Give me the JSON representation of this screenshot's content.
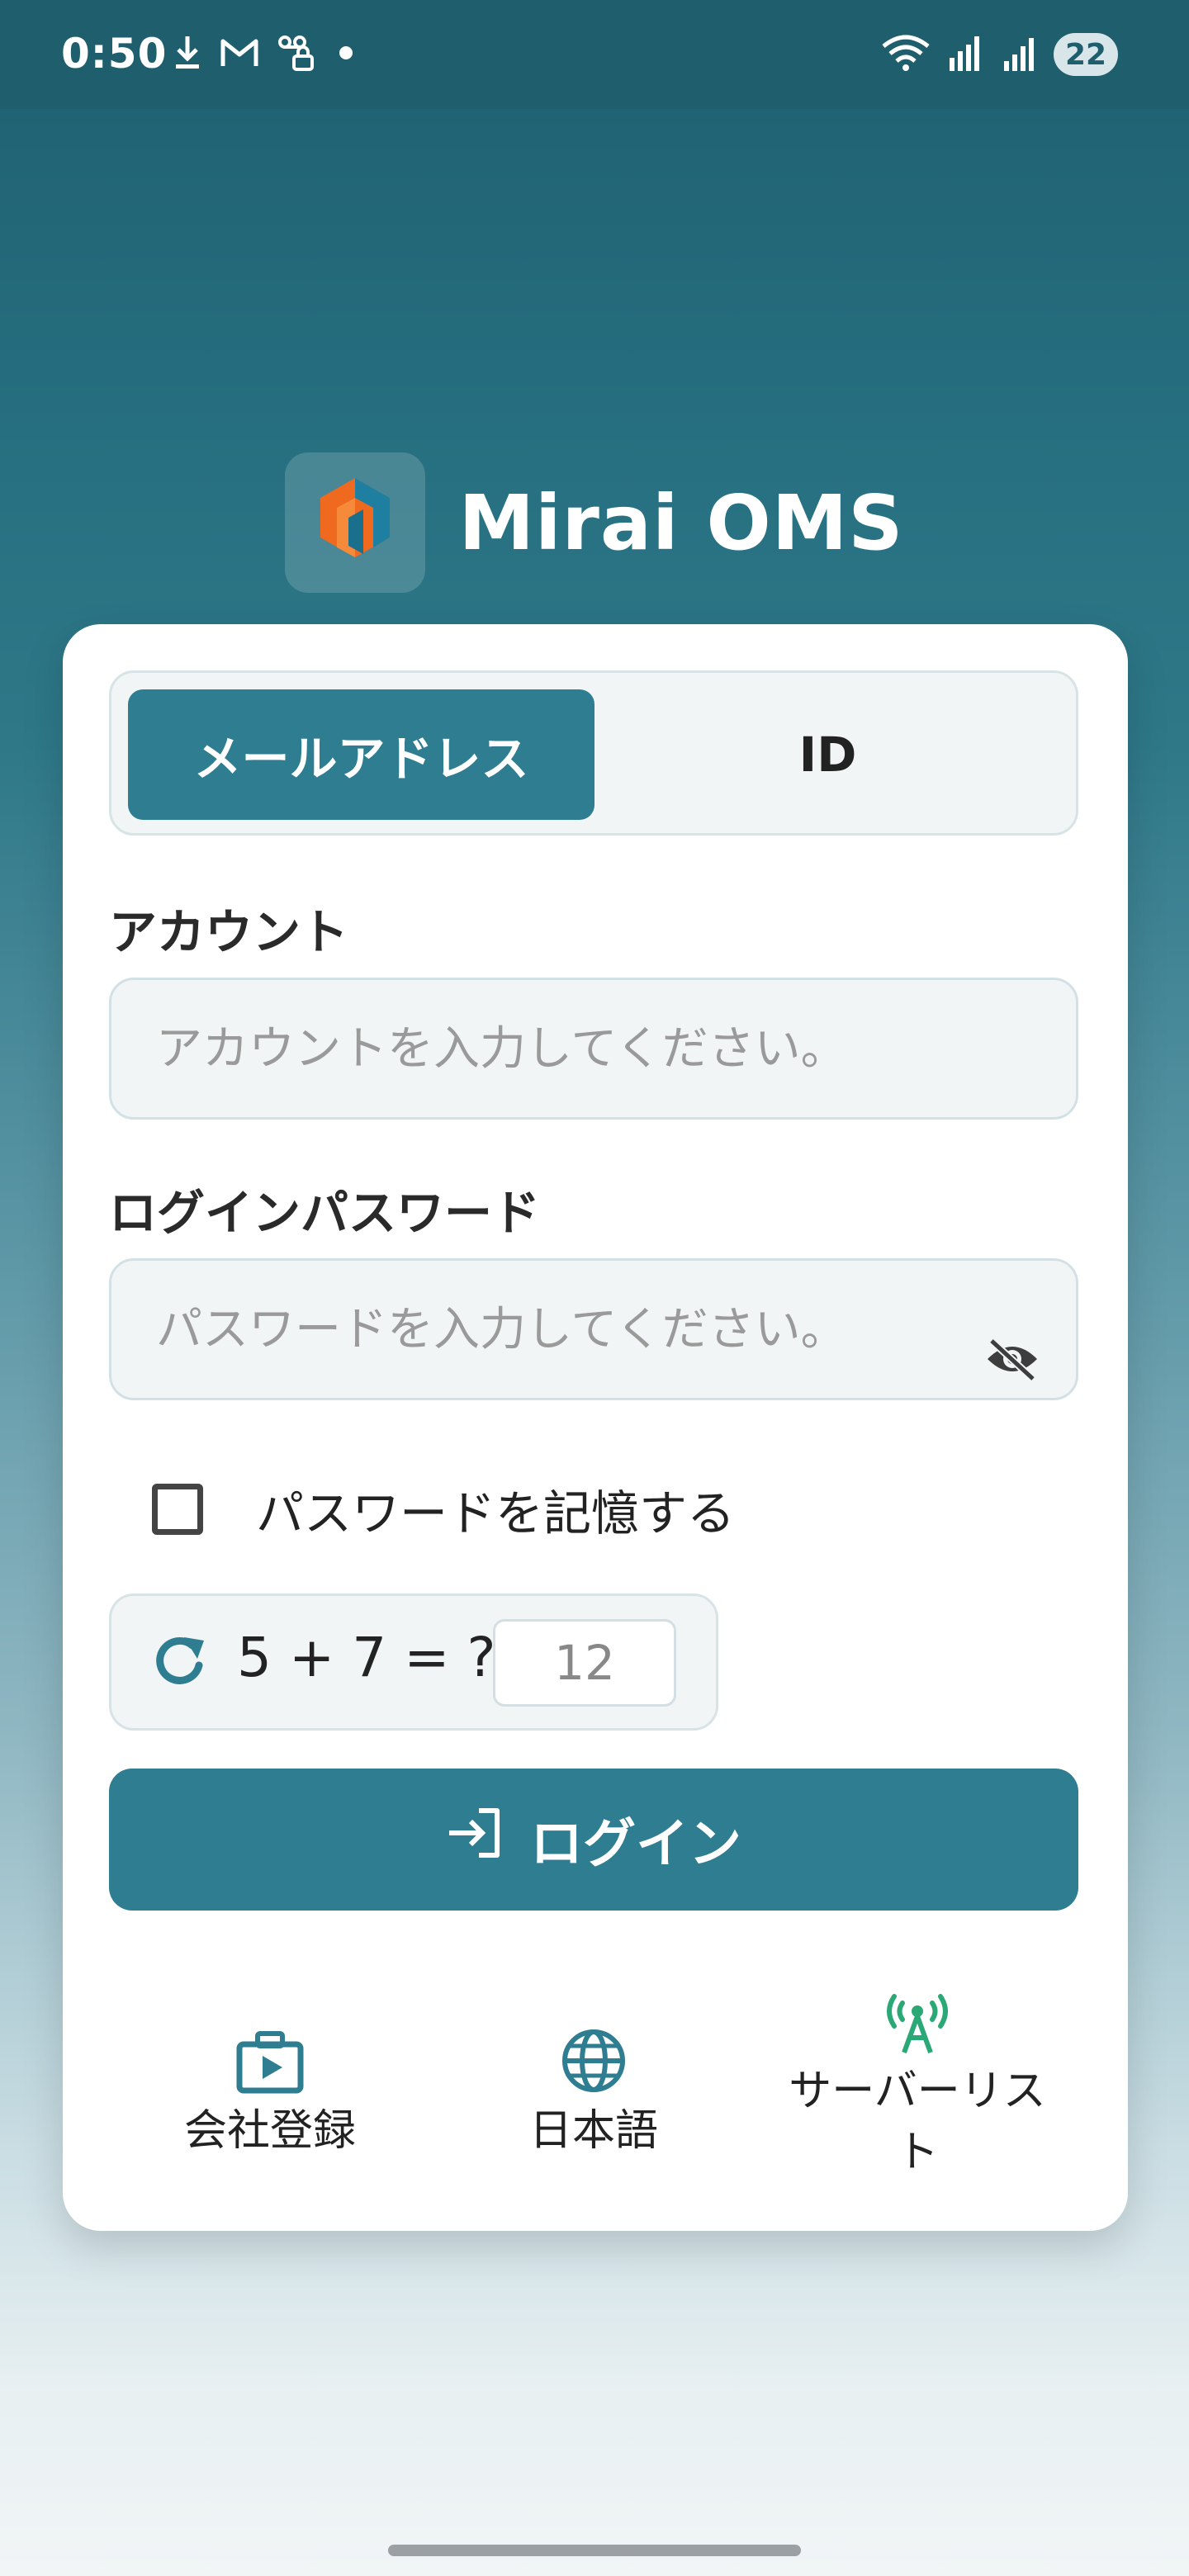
{
  "status_bar": {
    "time": "0:50",
    "battery": "22",
    "icons": [
      "download-icon",
      "gmail-icon",
      "voicemail-lock-icon",
      "dot-icon",
      "wifi-icon",
      "signal-r-icon",
      "signal-icon"
    ]
  },
  "brand": {
    "name": "Mirai OMS",
    "logo_icon": "mirai-logo-icon"
  },
  "login_mode": {
    "options": [
      {
        "label": "メールアドレス",
        "selected": true
      },
      {
        "label": "ID",
        "selected": false
      }
    ]
  },
  "account": {
    "label": "アカウント",
    "placeholder": "アカウントを入力してください。",
    "value": ""
  },
  "password": {
    "label": "ログインパスワード",
    "placeholder": "パスワードを入力してください。",
    "value": "",
    "toggle_icon": "eye-off-icon"
  },
  "remember": {
    "label": "パスワードを記憶する",
    "checked": false
  },
  "captcha": {
    "question": "5 + 7 = ?",
    "answer_placeholder": "12",
    "refresh_icon": "refresh-icon"
  },
  "login_button": {
    "label": "ログイン",
    "icon": "login-icon"
  },
  "bottom_actions": [
    {
      "label": "会社登録",
      "icon": "briefcase-play-icon"
    },
    {
      "label": "日本語",
      "icon": "globe-icon"
    },
    {
      "label": "サーバーリスト",
      "icon": "antenna-icon"
    }
  ],
  "colors": {
    "primary": "#2f7d90",
    "header": "#1f5e6d",
    "antenna": "#2aa876"
  }
}
